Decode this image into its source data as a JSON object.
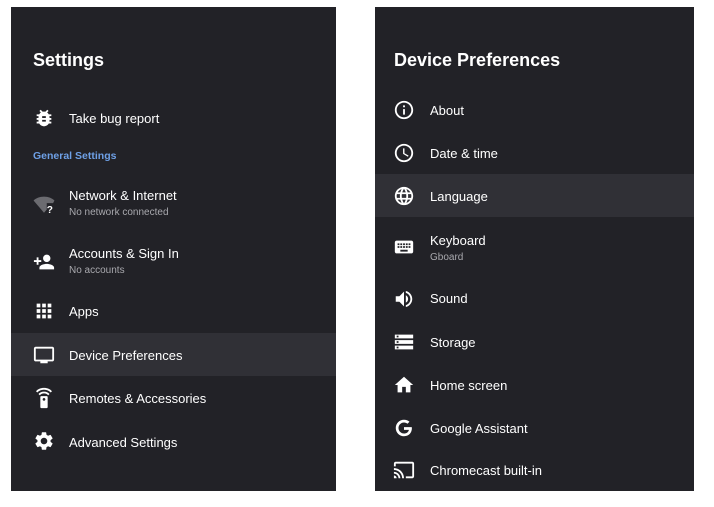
{
  "left": {
    "title": "Settings",
    "bug_report": "Take bug report",
    "section": "General Settings",
    "items": [
      {
        "label": "Network & Internet",
        "sub": "No network connected",
        "icon": "wifi-unknown-icon"
      },
      {
        "label": "Accounts & Sign In",
        "sub": "No accounts",
        "icon": "add-person-icon"
      },
      {
        "label": "Apps",
        "icon": "apps-grid-icon"
      },
      {
        "label": "Device Preferences",
        "icon": "tv-icon",
        "selected": true
      },
      {
        "label": "Remotes & Accessories",
        "icon": "remote-icon"
      },
      {
        "label": "Advanced Settings",
        "icon": "gear-icon"
      }
    ]
  },
  "right": {
    "title": "Device Preferences",
    "items": [
      {
        "label": "About",
        "icon": "info-icon"
      },
      {
        "label": "Date & time",
        "icon": "clock-icon"
      },
      {
        "label": "Language",
        "icon": "globe-icon",
        "selected": true
      },
      {
        "label": "Keyboard",
        "sub": "Gboard",
        "icon": "keyboard-icon"
      },
      {
        "label": "Sound",
        "icon": "speaker-icon"
      },
      {
        "label": "Storage",
        "icon": "storage-icon"
      },
      {
        "label": "Home screen",
        "icon": "home-icon"
      },
      {
        "label": "Google Assistant",
        "icon": "google-icon"
      },
      {
        "label": "Chromecast built-in",
        "icon": "cast-icon"
      }
    ]
  },
  "colors": {
    "panel_bg": "#222227",
    "selected_bg": "#303036",
    "section_label": "#6ea0e6"
  }
}
